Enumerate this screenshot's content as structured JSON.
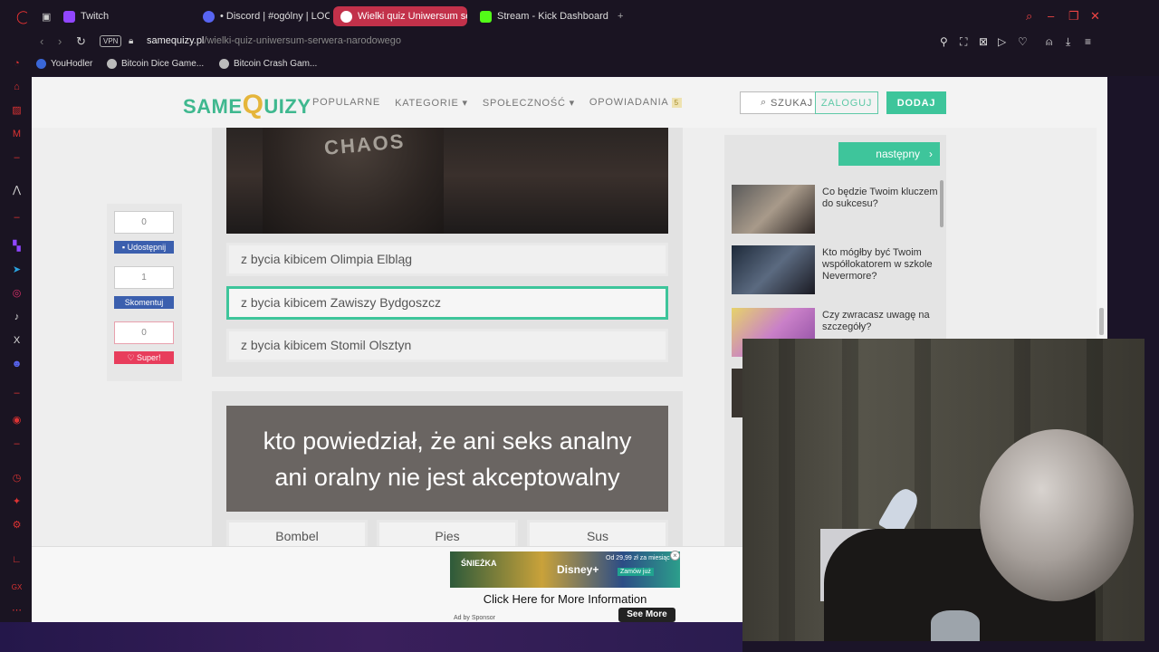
{
  "browser": {
    "tabs": [
      {
        "label": "Twitch",
        "color": "#9146ff"
      },
      {
        "label": "• Discord | #ogólny | LOC",
        "color": "#5865f2"
      },
      {
        "label": "Wielki quiz Uniwersum se",
        "color": "#c2314a"
      },
      {
        "label": "Stream - Kick Dashboard",
        "color": "#53fc18"
      }
    ],
    "new_tab": "+",
    "vpn": "VPN",
    "url_domain": "samequizy.pl",
    "url_path": "/wielki-quiz-uniwersum-serwera-narodowego",
    "bookmarks": [
      "YouHodler",
      "Bitcoin Dice Game...",
      "Bitcoin Crash Gam..."
    ]
  },
  "site": {
    "logo_same": "SAME",
    "logo_q": "Q",
    "logo_uizy": "UIZY",
    "menu": [
      "POPULARNE",
      "KATEGORIE ▾",
      "SPOŁECZNOŚĆ ▾",
      "OPOWIADANIA"
    ],
    "menu_badge": "5",
    "search": "SZUKAJ",
    "login": "ZALOGUJ",
    "add": "DODAJ"
  },
  "social": {
    "share_count": "0",
    "share_label": "Udostępnij",
    "comment_count": "1",
    "comment_label": "Skomentuj",
    "super_count": "0",
    "super_label": "Super!"
  },
  "quiz": {
    "image_text": "CHAOS",
    "answers": [
      "z bycia kibicem Olimpia Elbląg",
      "z bycia kibicem Zawiszy Bydgoszcz",
      "z bycia kibicem Stomil Olsztyn"
    ],
    "selected_index": 1,
    "next_question": "kto powiedział, że ani seks analny ani oralny nie jest akceptowalny",
    "options": [
      "Bombel",
      "Pies",
      "Sus"
    ]
  },
  "sidebar_right": {
    "next_label": "następny",
    "recommendations": [
      "Co będzie Twoim kluczem do sukcesu?",
      "Kto mógłby być Twoim współlokatorem w szkole Nevermore?",
      "Czy zwracasz uwagę na szczegóły?"
    ]
  },
  "ad": {
    "brand": "ŚNIEŻKA",
    "partner": "Disney+",
    "price": "Od 29,99 zł za miesiąc",
    "cta_small": "Zamów już",
    "headline": "Click Here for More Information",
    "by": "Ad by Sponsor",
    "button": "See More",
    "close": "×"
  }
}
